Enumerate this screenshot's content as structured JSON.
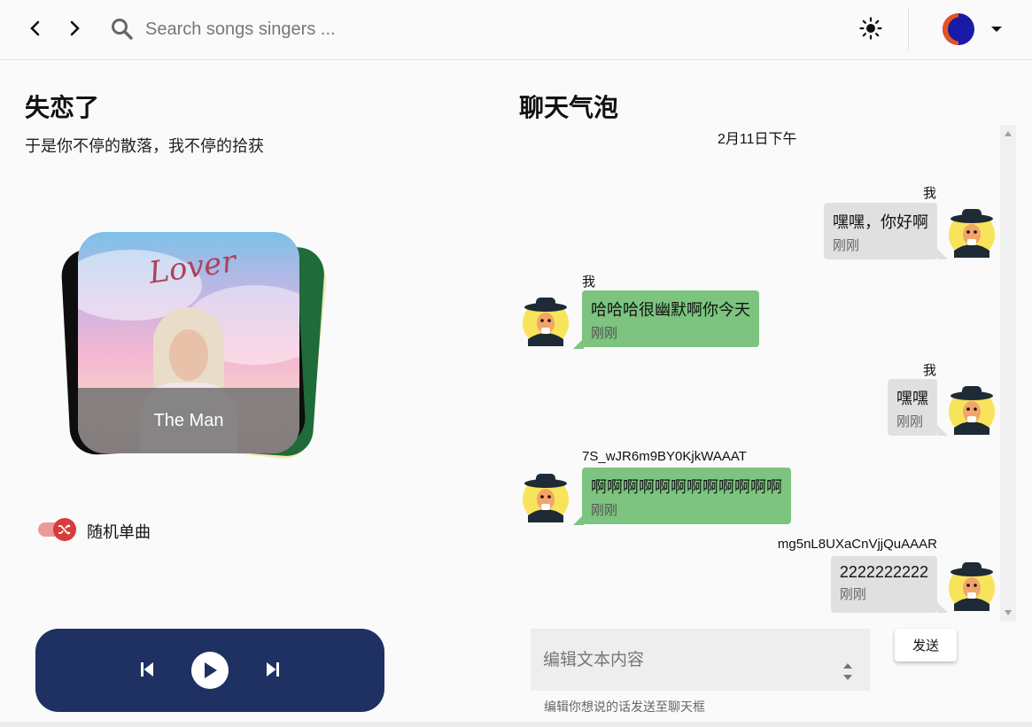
{
  "header": {
    "back_icon": "chevron-left-icon",
    "forward_icon": "chevron-right-icon",
    "search_icon": "search-icon",
    "search_placeholder": "Search songs singers ...",
    "theme_icon": "sun-icon",
    "avatar_icon": "user-avatar",
    "menu_icon": "caret-down-icon"
  },
  "song": {
    "title": "失恋了",
    "lyric": "于是你不停的散落，我不停的拾获",
    "cover_title": "The Man",
    "cover_script": "Lover"
  },
  "shuffle": {
    "label": "随机单曲",
    "enabled": true
  },
  "player": {
    "prev_icon": "skip-previous-icon",
    "play_icon": "play-icon",
    "next_icon": "skip-next-icon"
  },
  "chat": {
    "title": "聊天气泡",
    "date": "2月11日下午",
    "messages": [
      {
        "side": "right",
        "name": "我",
        "text": "嘿嘿，你好啊",
        "time": "刚刚"
      },
      {
        "side": "left",
        "name": "我",
        "text": "哈哈哈很幽默啊你今天",
        "time": "刚刚"
      },
      {
        "side": "right",
        "name": "我",
        "text": "嘿嘿",
        "time": "刚刚"
      },
      {
        "side": "left",
        "name": "7S_wJR6m9BY0KjkWAAAT",
        "text": "啊啊啊啊啊啊啊啊啊啊啊啊",
        "time": "刚刚"
      },
      {
        "side": "right",
        "name": "mg5nL8UXaCnVjjQuAAAR",
        "text": "2222222222",
        "time": "刚刚"
      }
    ],
    "input_placeholder": "编辑文本内容",
    "input_hint": "编辑你想说的话发送至聊天框",
    "send_label": "发送"
  },
  "colors": {
    "player_bg": "#1f3163",
    "bubble_self": "#e0e0e0",
    "bubble_other": "#7cc47f",
    "shuffle_accent": "#d83c3b"
  }
}
